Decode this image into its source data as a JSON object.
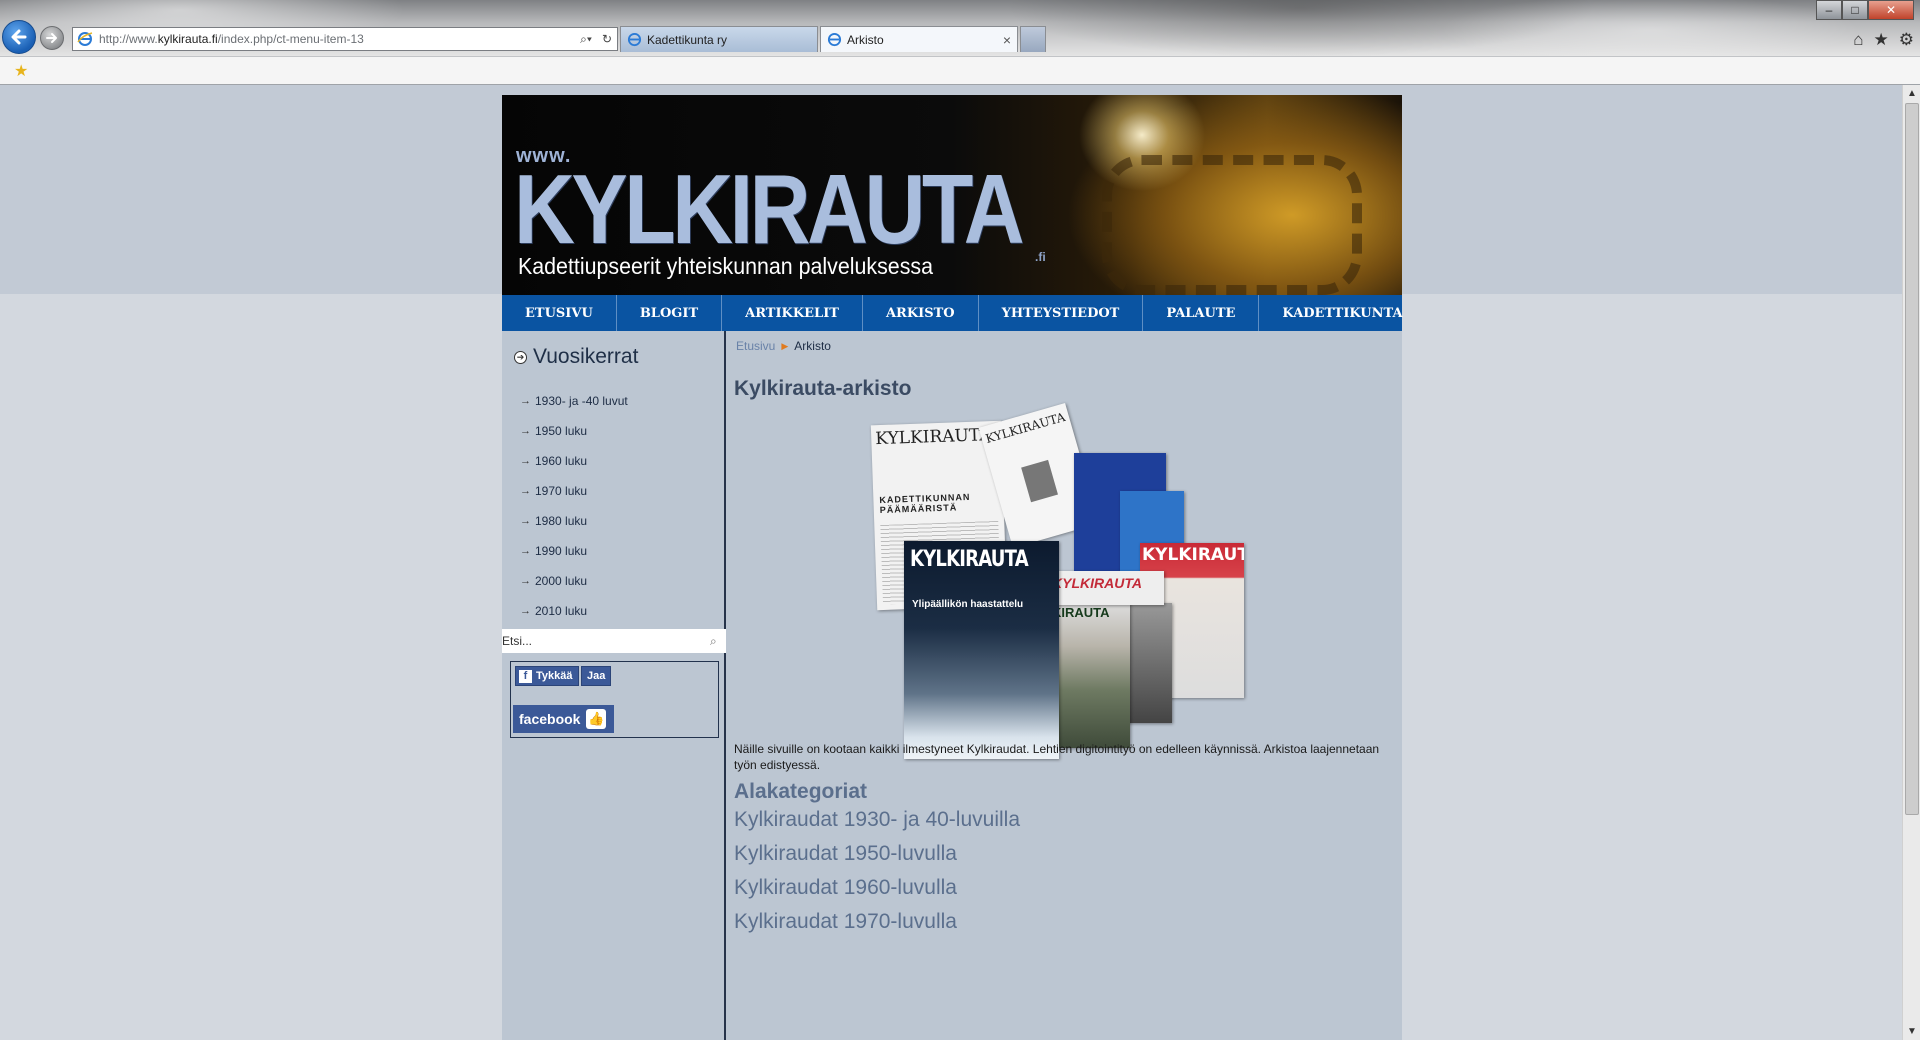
{
  "browser": {
    "address_prefix": "http://www.",
    "address_domain": "kylkirauta.fi",
    "address_path": "/index.php/ct-menu-item-13",
    "tabs": [
      {
        "label": "Kadettikunta ry",
        "active": false
      },
      {
        "label": "Arkisto",
        "active": true
      }
    ],
    "tab_close": "×",
    "window_controls": {
      "minimize": "–",
      "maximize": "□",
      "close": "✕"
    },
    "icons": [
      "home-icon",
      "star-icon",
      "gear-icon"
    ]
  },
  "site": {
    "banner_www": "www.",
    "banner_title": "KYLKIRAUTA",
    "banner_tld": ".fi",
    "banner_tagline": "Kadettiupseerit yhteiskunnan palveluksessa",
    "nav": [
      "ETUSIVU",
      "BLOGIT",
      "ARTIKKELIT",
      "ARKISTO",
      "YHTEYSTIEDOT",
      "PALAUTE",
      "KADETTIKUNTA"
    ]
  },
  "sidebar": {
    "heading": "Vuosikerrat",
    "years": [
      "1930- ja -40 luvut",
      "1950 luku",
      "1960 luku",
      "1970 luku",
      "1980 luku",
      "1990 luku",
      "2000 luku",
      "2010 luku"
    ],
    "search_placeholder": "Etsi...",
    "facebook": {
      "like": "Tykkää",
      "share": "Jaa",
      "logo": "facebook"
    }
  },
  "main": {
    "breadcrumb_home": "Etusivu",
    "breadcrumb_current": "Arkisto",
    "title": "Kylkirauta-arkisto",
    "collage": {
      "paper1_title": "KYLKIRAUTA",
      "paper1_heading": "KADETTIKUNNAN PÄÄMÄÄRISTÄ",
      "paper2_title": "KYLKIRAUTA",
      "main_cover_title": "KYLKIRAUTA",
      "main_cover_subtitle": "Ylipäällikön haastattelu",
      "red_cover_title": "KYLKIRAUTA",
      "red_strip_title": "KYLKIRAUTA",
      "army_cover_title": "KIRAUTA"
    },
    "intro": "Näille sivuille on kootaan kaikki ilmestyneet Kylkiraudat. Lehtien digitointityö on edelleen käynnissä. Arkistoa laajennetaan työn edistyessä.",
    "subcategories_heading": "Alakategoriat",
    "subcategories": [
      "Kylkiraudat 1930- ja 40-luvuilla",
      "Kylkiraudat 1950-luvulla",
      "Kylkiraudat 1960-luvulla",
      "Kylkiraudat 1970-luvulla"
    ]
  },
  "colors": {
    "nav_bg": "#0a54a2",
    "content_bg": "#bcc6d2",
    "link": "#5b6f8d",
    "breadcrumb_sep": "#e07b1f",
    "facebook": "#3b5998"
  }
}
